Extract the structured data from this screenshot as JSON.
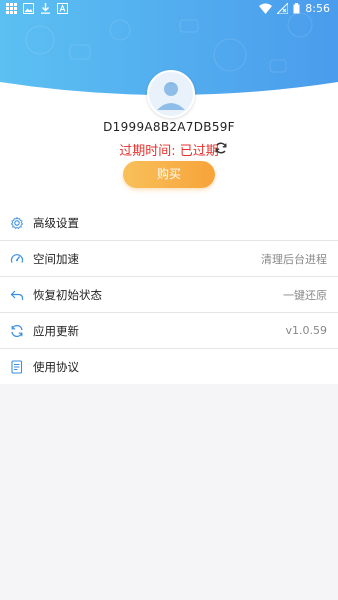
{
  "status_bar": {
    "time": "8:56",
    "icons": [
      "grid-icon",
      "image-icon",
      "download-icon",
      "app-icon",
      "wifi-icon",
      "no-signal-icon",
      "battery-icon"
    ]
  },
  "profile": {
    "device_id": "D1999A8B2A7DB59F",
    "expire_label": "过期时间: 已过期",
    "buy_label": "购买"
  },
  "menu": {
    "items": [
      {
        "label": "高级设置",
        "value": "",
        "icon": "gear-icon"
      },
      {
        "label": "空间加速",
        "value": "清理后台进程",
        "icon": "speedometer-icon"
      },
      {
        "label": "恢复初始状态",
        "value": "一键还原",
        "icon": "undo-icon"
      },
      {
        "label": "应用更新",
        "value": "v1.0.59",
        "icon": "sync-icon"
      },
      {
        "label": "使用协议",
        "value": "",
        "icon": "document-icon"
      }
    ]
  },
  "colors": {
    "header_blue": "#5aa8ee",
    "accent_orange": "#f7a33a",
    "expire_red": "#e5322d",
    "icon_blue": "#3a8fe0"
  }
}
